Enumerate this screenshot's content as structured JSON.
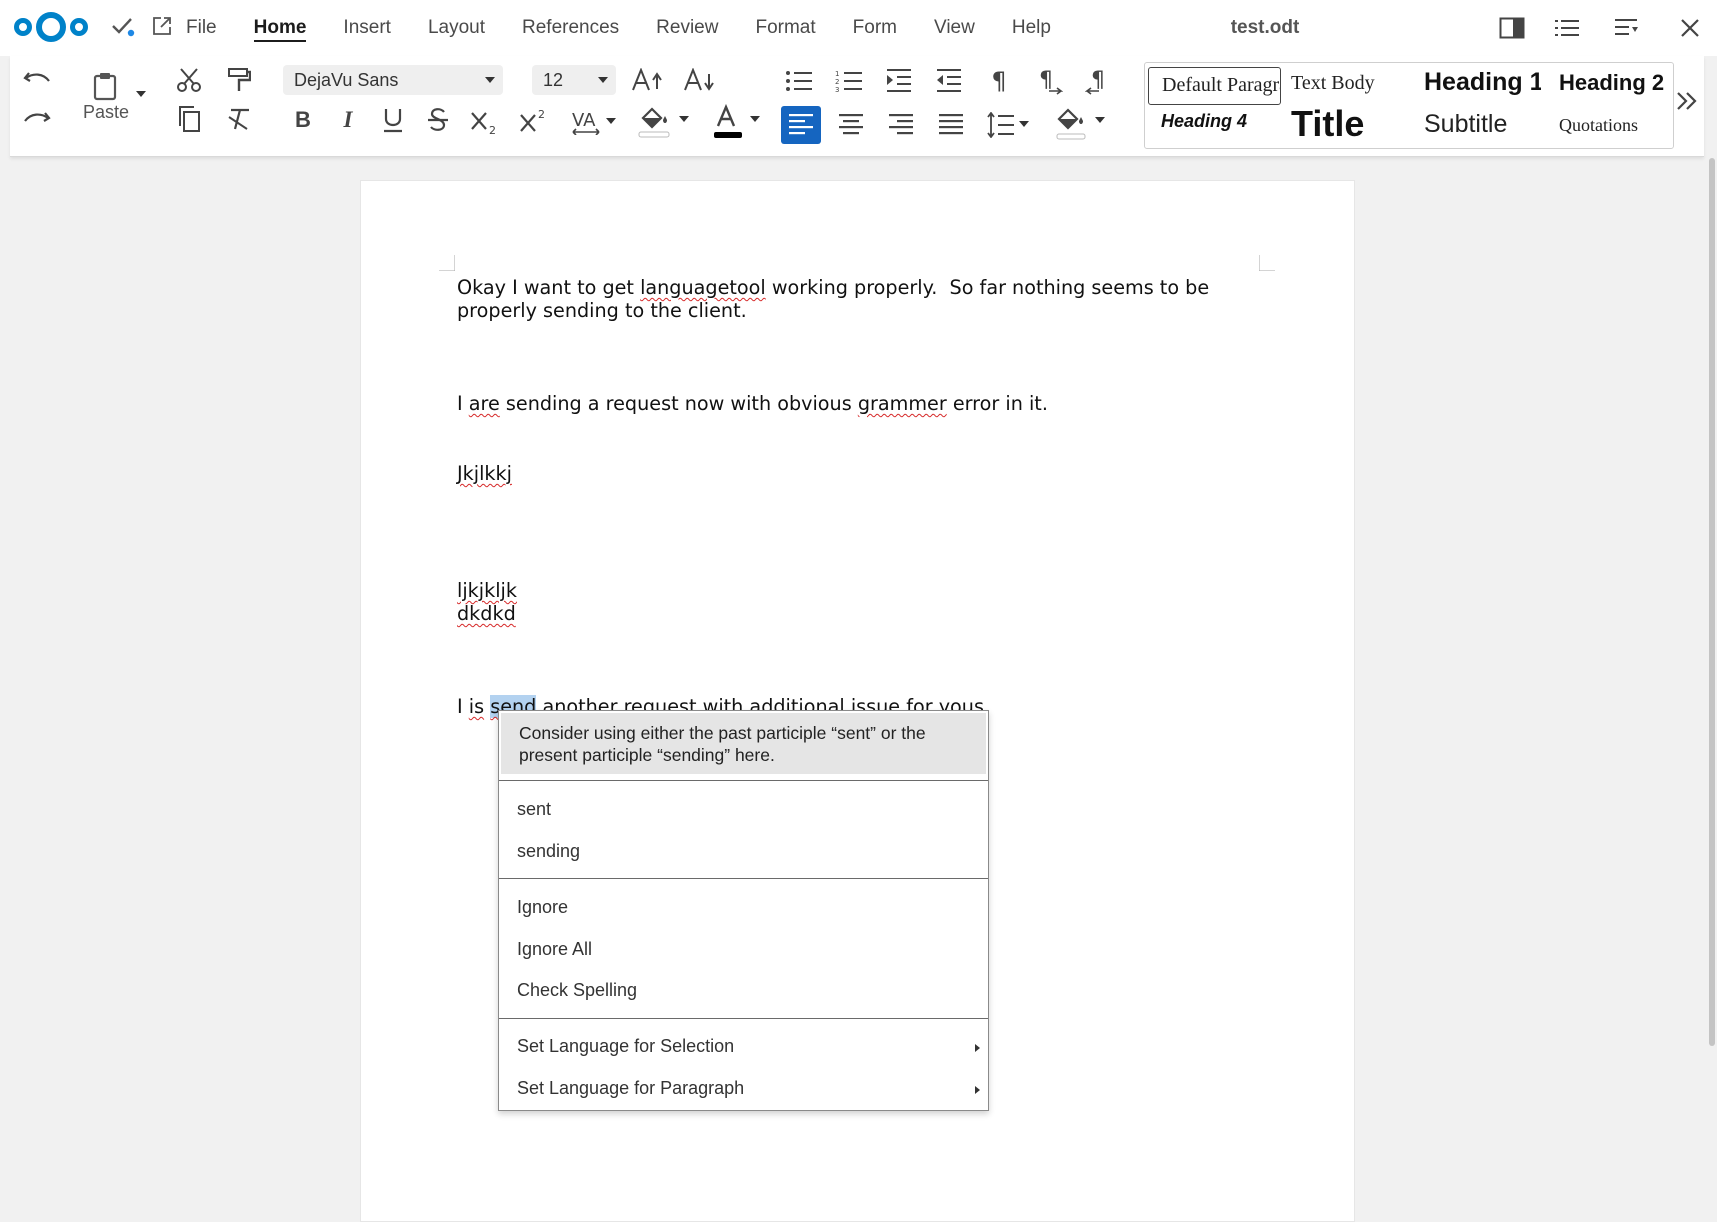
{
  "app": {
    "document_title": "test.odt",
    "menu": [
      "File",
      "Home",
      "Insert",
      "Layout",
      "References",
      "Review",
      "Format",
      "Form",
      "View",
      "Help"
    ],
    "active_menu": "Home"
  },
  "ribbon": {
    "paste_label": "Paste",
    "font_name": "DejaVu Sans",
    "font_size": "12",
    "styles": [
      "Default Paragraph Style",
      "Text Body",
      "Heading 1",
      "Heading 2",
      "Heading 4",
      "Title",
      "Subtitle",
      "Quotations"
    ],
    "selected_style": "Default Paragraph Style",
    "accent_color": "#1565c0",
    "font_color": "#000000"
  },
  "document": {
    "paragraphs": {
      "p1_line1_a": "Okay I want to get ",
      "p1_err": "languagetool",
      "p1_line1_b": " working properly.  So far nothing seems to be",
      "p1_line2": "properly sending to the client.",
      "p2_a": "I ",
      "p2_err1": "are",
      "p2_b": " sending a request now with obvious ",
      "p2_err2": "grammer",
      "p2_c": " error in it.",
      "p3": "Jkjlkkj",
      "p4_line1": "ljkjkljk",
      "p4_line2": "dkdkd",
      "p5_a": "I ",
      "p5_err1": "is",
      "p5_sp": " ",
      "p5_sel": "send",
      "p5_b": " another request with additional issue for ",
      "p5_err2": "yous",
      "p5_c": "."
    }
  },
  "context_menu": {
    "message": "Consider using either the past participle “sent” or the present participle “sending” here.",
    "suggestions": [
      "sent",
      "sending"
    ],
    "actions": [
      "Ignore",
      "Ignore All",
      "Check Spelling"
    ],
    "language": [
      "Set Language for Selection",
      "Set Language for Paragraph"
    ]
  }
}
